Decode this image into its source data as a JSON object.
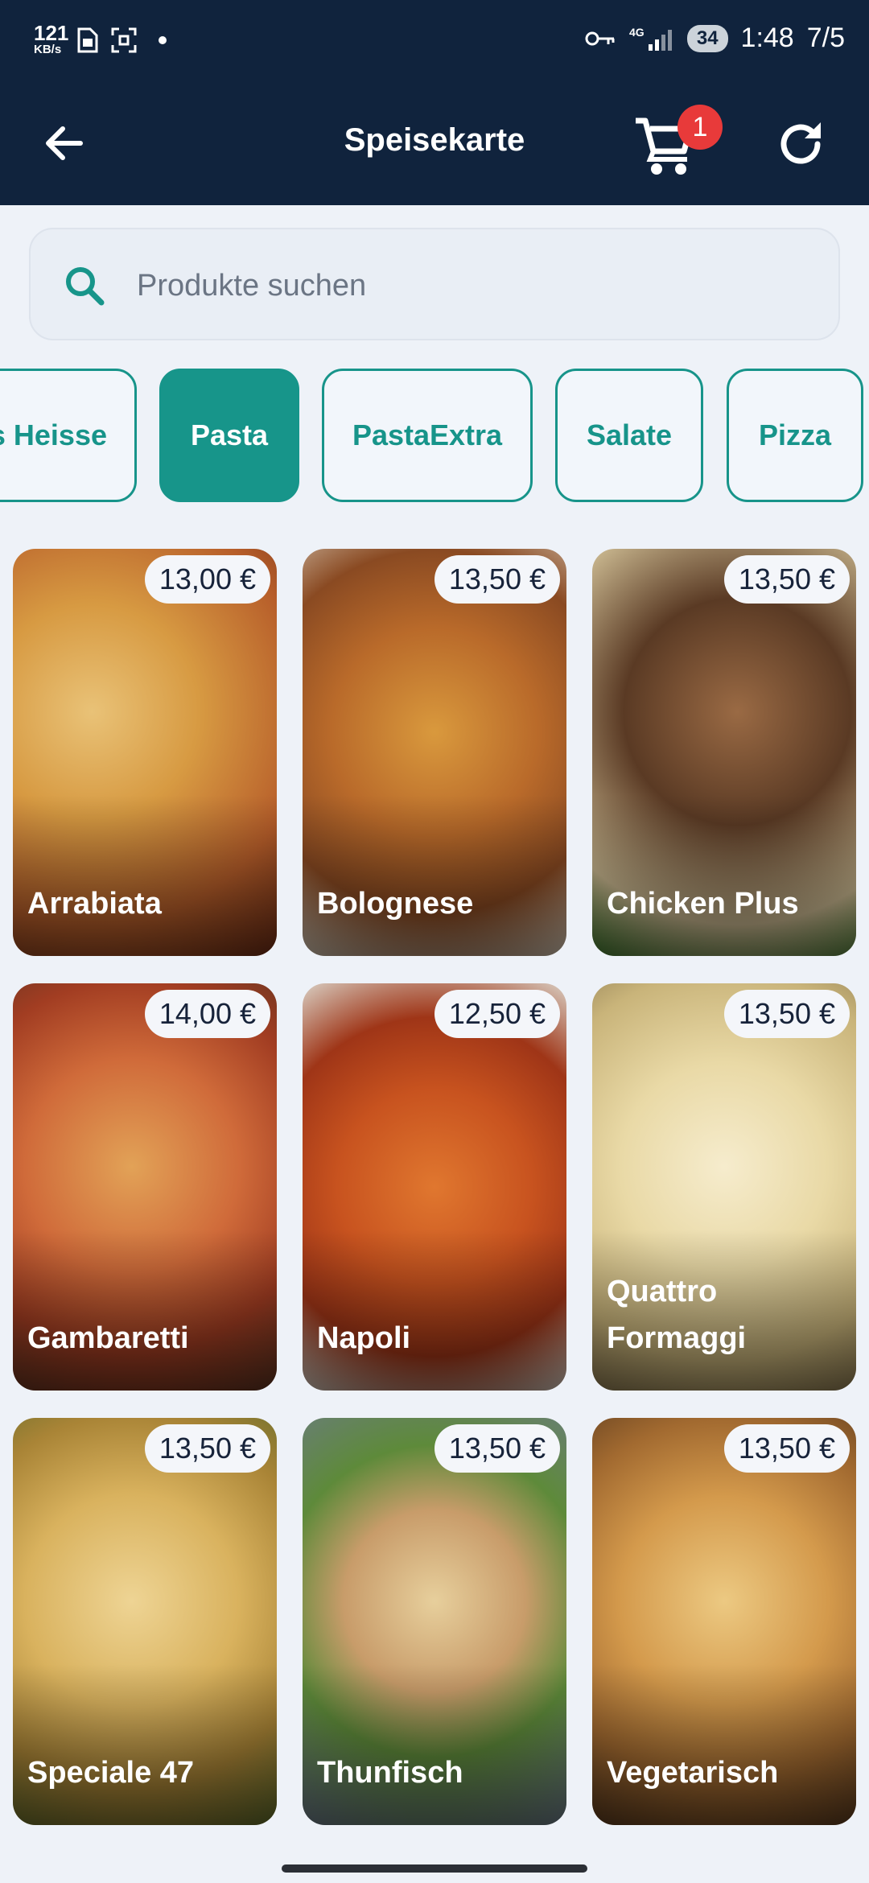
{
  "status_bar": {
    "speed_value": "121",
    "speed_unit": "KB/s",
    "battery": "34",
    "time": "1:48",
    "date": "7/5"
  },
  "app_bar": {
    "title": "Speisekarte",
    "cart_count": "1"
  },
  "search": {
    "placeholder": "Produkte suchen"
  },
  "categories": [
    {
      "label": "s Heisse",
      "active": false
    },
    {
      "label": "Pasta",
      "active": true
    },
    {
      "label": "PastaExtra",
      "active": false
    },
    {
      "label": "Salate",
      "active": false
    },
    {
      "label": "Pizza",
      "active": false
    }
  ],
  "products": [
    {
      "name": "Arrabiata",
      "price": "13,00 €"
    },
    {
      "name": "Bolognese",
      "price": "13,50 €"
    },
    {
      "name": "Chicken Plus",
      "price": "13,50 €"
    },
    {
      "name": "Gambaretti",
      "price": "14,00 €"
    },
    {
      "name": "Napoli",
      "price": "12,50 €"
    },
    {
      "name": "Quattro Formaggi",
      "price": "13,50 €"
    },
    {
      "name": "Speciale 47",
      "price": "13,50 €"
    },
    {
      "name": "Thunfisch",
      "price": "13,50 €"
    },
    {
      "name": "Vegetarisch",
      "price": "13,50 €"
    }
  ],
  "colors": {
    "header_bg": "#10233d",
    "accent": "#17958a",
    "badge": "#e83a3a",
    "page_bg": "#eef2f8"
  }
}
